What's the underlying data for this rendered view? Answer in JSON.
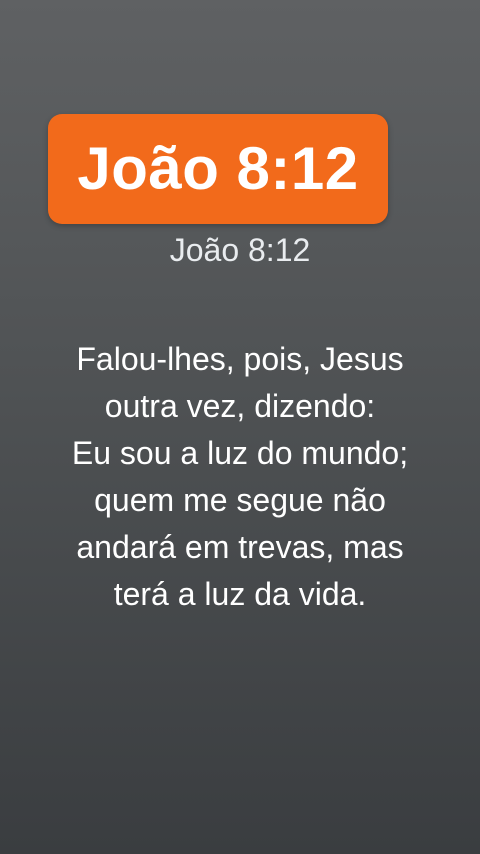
{
  "colors": {
    "badge_background": "#f26a1b",
    "text": "#ffffff"
  },
  "header": {
    "title": "João 8:12",
    "reference": "João 8:12"
  },
  "verse": {
    "lines": [
      "Falou-lhes, pois, Jesus",
      "outra vez, dizendo:",
      "Eu sou a luz do mundo;",
      "quem me segue não",
      "andará em trevas, mas",
      "terá a luz da vida."
    ]
  }
}
